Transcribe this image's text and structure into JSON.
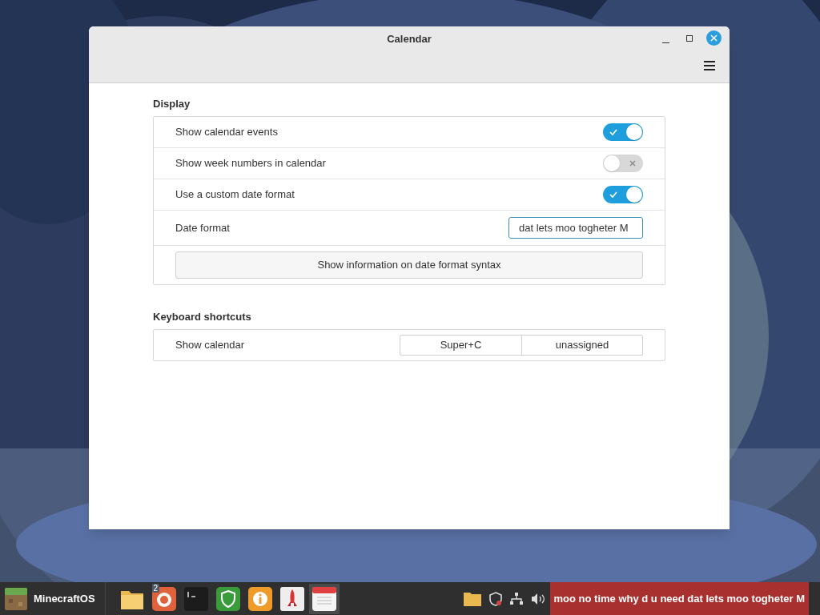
{
  "window": {
    "title": "Calendar"
  },
  "sections": [
    {
      "title": "Display",
      "rows": [
        {
          "kind": "toggle",
          "label": "Show calendar events",
          "on": true
        },
        {
          "kind": "toggle",
          "label": "Show week numbers in calendar",
          "on": false
        },
        {
          "kind": "toggle",
          "label": "Use a custom date format",
          "on": true
        },
        {
          "kind": "entry",
          "label": "Date format",
          "value": "dat lets moo togheter M"
        },
        {
          "kind": "button",
          "label": "Show information on date format syntax"
        }
      ]
    },
    {
      "title": "Keyboard shortcuts",
      "rows": [
        {
          "kind": "shortcut",
          "label": "Show calendar",
          "keys": [
            "Super+C",
            "unassigned"
          ]
        }
      ]
    }
  ],
  "taskbar": {
    "menu_label": "MinecraftOS",
    "launchers": [
      {
        "active": false
      },
      {
        "active": false,
        "badge": "2"
      },
      {
        "active": false
      },
      {
        "active": false
      },
      {
        "active": false
      },
      {
        "active": false
      },
      {
        "active": true
      }
    ],
    "applet_text": "moo no time why d u need dat lets moo togheter M"
  }
}
